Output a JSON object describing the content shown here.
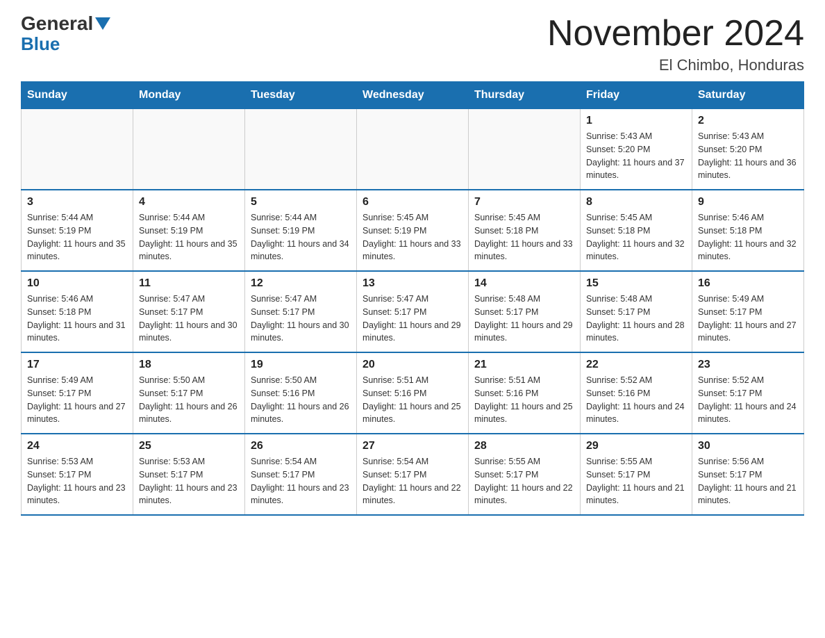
{
  "header": {
    "logo_line1_black": "General",
    "logo_line1_blue": "",
    "logo_line2": "Blue",
    "title": "November 2024",
    "subtitle": "El Chimbo, Honduras"
  },
  "days_of_week": [
    "Sunday",
    "Monday",
    "Tuesday",
    "Wednesday",
    "Thursday",
    "Friday",
    "Saturday"
  ],
  "weeks": [
    [
      {
        "day": "",
        "info": ""
      },
      {
        "day": "",
        "info": ""
      },
      {
        "day": "",
        "info": ""
      },
      {
        "day": "",
        "info": ""
      },
      {
        "day": "",
        "info": ""
      },
      {
        "day": "1",
        "info": "Sunrise: 5:43 AM\nSunset: 5:20 PM\nDaylight: 11 hours and 37 minutes."
      },
      {
        "day": "2",
        "info": "Sunrise: 5:43 AM\nSunset: 5:20 PM\nDaylight: 11 hours and 36 minutes."
      }
    ],
    [
      {
        "day": "3",
        "info": "Sunrise: 5:44 AM\nSunset: 5:19 PM\nDaylight: 11 hours and 35 minutes."
      },
      {
        "day": "4",
        "info": "Sunrise: 5:44 AM\nSunset: 5:19 PM\nDaylight: 11 hours and 35 minutes."
      },
      {
        "day": "5",
        "info": "Sunrise: 5:44 AM\nSunset: 5:19 PM\nDaylight: 11 hours and 34 minutes."
      },
      {
        "day": "6",
        "info": "Sunrise: 5:45 AM\nSunset: 5:19 PM\nDaylight: 11 hours and 33 minutes."
      },
      {
        "day": "7",
        "info": "Sunrise: 5:45 AM\nSunset: 5:18 PM\nDaylight: 11 hours and 33 minutes."
      },
      {
        "day": "8",
        "info": "Sunrise: 5:45 AM\nSunset: 5:18 PM\nDaylight: 11 hours and 32 minutes."
      },
      {
        "day": "9",
        "info": "Sunrise: 5:46 AM\nSunset: 5:18 PM\nDaylight: 11 hours and 32 minutes."
      }
    ],
    [
      {
        "day": "10",
        "info": "Sunrise: 5:46 AM\nSunset: 5:18 PM\nDaylight: 11 hours and 31 minutes."
      },
      {
        "day": "11",
        "info": "Sunrise: 5:47 AM\nSunset: 5:17 PM\nDaylight: 11 hours and 30 minutes."
      },
      {
        "day": "12",
        "info": "Sunrise: 5:47 AM\nSunset: 5:17 PM\nDaylight: 11 hours and 30 minutes."
      },
      {
        "day": "13",
        "info": "Sunrise: 5:47 AM\nSunset: 5:17 PM\nDaylight: 11 hours and 29 minutes."
      },
      {
        "day": "14",
        "info": "Sunrise: 5:48 AM\nSunset: 5:17 PM\nDaylight: 11 hours and 29 minutes."
      },
      {
        "day": "15",
        "info": "Sunrise: 5:48 AM\nSunset: 5:17 PM\nDaylight: 11 hours and 28 minutes."
      },
      {
        "day": "16",
        "info": "Sunrise: 5:49 AM\nSunset: 5:17 PM\nDaylight: 11 hours and 27 minutes."
      }
    ],
    [
      {
        "day": "17",
        "info": "Sunrise: 5:49 AM\nSunset: 5:17 PM\nDaylight: 11 hours and 27 minutes."
      },
      {
        "day": "18",
        "info": "Sunrise: 5:50 AM\nSunset: 5:17 PM\nDaylight: 11 hours and 26 minutes."
      },
      {
        "day": "19",
        "info": "Sunrise: 5:50 AM\nSunset: 5:16 PM\nDaylight: 11 hours and 26 minutes."
      },
      {
        "day": "20",
        "info": "Sunrise: 5:51 AM\nSunset: 5:16 PM\nDaylight: 11 hours and 25 minutes."
      },
      {
        "day": "21",
        "info": "Sunrise: 5:51 AM\nSunset: 5:16 PM\nDaylight: 11 hours and 25 minutes."
      },
      {
        "day": "22",
        "info": "Sunrise: 5:52 AM\nSunset: 5:16 PM\nDaylight: 11 hours and 24 minutes."
      },
      {
        "day": "23",
        "info": "Sunrise: 5:52 AM\nSunset: 5:17 PM\nDaylight: 11 hours and 24 minutes."
      }
    ],
    [
      {
        "day": "24",
        "info": "Sunrise: 5:53 AM\nSunset: 5:17 PM\nDaylight: 11 hours and 23 minutes."
      },
      {
        "day": "25",
        "info": "Sunrise: 5:53 AM\nSunset: 5:17 PM\nDaylight: 11 hours and 23 minutes."
      },
      {
        "day": "26",
        "info": "Sunrise: 5:54 AM\nSunset: 5:17 PM\nDaylight: 11 hours and 23 minutes."
      },
      {
        "day": "27",
        "info": "Sunrise: 5:54 AM\nSunset: 5:17 PM\nDaylight: 11 hours and 22 minutes."
      },
      {
        "day": "28",
        "info": "Sunrise: 5:55 AM\nSunset: 5:17 PM\nDaylight: 11 hours and 22 minutes."
      },
      {
        "day": "29",
        "info": "Sunrise: 5:55 AM\nSunset: 5:17 PM\nDaylight: 11 hours and 21 minutes."
      },
      {
        "day": "30",
        "info": "Sunrise: 5:56 AM\nSunset: 5:17 PM\nDaylight: 11 hours and 21 minutes."
      }
    ]
  ]
}
